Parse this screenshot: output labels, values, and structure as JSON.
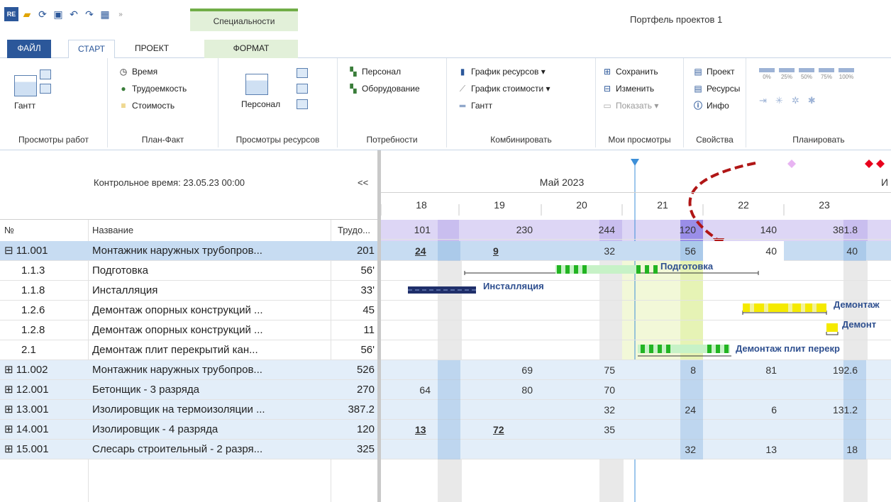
{
  "app": {
    "window_title": "Портфель проектов 1",
    "context_tab": "Специальности"
  },
  "tabs": [
    "ФАЙЛ",
    "СТАРТ",
    "ПРОЕКТ",
    "ФОРМАТ"
  ],
  "ribbon": {
    "work_views": {
      "label": "Просмотры работ",
      "gantt": "Гантт"
    },
    "plan_fact": {
      "label": "План-Факт",
      "items": [
        "Время",
        "Трудоемкость",
        "Стоимость"
      ]
    },
    "resource_views": {
      "label": "Просмотры ресурсов",
      "personnel": "Персонал"
    },
    "needs": {
      "label": "Потребности",
      "items": [
        "Персонал",
        "Оборудование"
      ]
    },
    "combine": {
      "label": "Комбинировать",
      "items": [
        "График ресурсов ▾",
        "График стоимости ▾",
        "Гантт"
      ]
    },
    "my_views": {
      "label": "Мои просмотры",
      "items": [
        "Сохранить",
        "Изменить",
        "Показать ▾"
      ]
    },
    "properties": {
      "label": "Свойства",
      "items": [
        "Проект",
        "Ресурсы",
        "Инфо"
      ]
    },
    "plan": {
      "label": "Планировать",
      "percent": [
        "0%",
        "25%",
        "50%",
        "75%",
        "100%"
      ]
    }
  },
  "control_time": "Контрольное время: 23.05.23 00:00",
  "collapse": "<<",
  "columns": {
    "num": "№",
    "name": "Название",
    "work": "Трудо..."
  },
  "timeline": {
    "month": "Май 2023",
    "next_month": "И",
    "days": [
      "18",
      "19",
      "20",
      "21",
      "22",
      "23"
    ],
    "totals": [
      "101",
      "230",
      "244",
      "120",
      "140",
      "381.8"
    ]
  },
  "rows": [
    {
      "num": "⊟ 11.001",
      "name": "Монтажник наружных трубопров...",
      "work": "201",
      "type": "sel",
      "days": [
        "24",
        "9",
        "32",
        "56",
        "40",
        "40"
      ],
      "underline": [
        0,
        1
      ]
    },
    {
      "num": "1.1.3",
      "name": "Подготовка",
      "work": "56'",
      "type": "task",
      "bar_label": "Подготовка"
    },
    {
      "num": "1.1.8",
      "name": "Инсталляция",
      "work": "33'",
      "type": "task",
      "bar_label": "Инсталляция"
    },
    {
      "num": "1.2.6",
      "name": "Демонтаж опорных конструкций ...",
      "work": "45",
      "type": "task",
      "bar_label": "Демонтаж"
    },
    {
      "num": "1.2.8",
      "name": "Демонтаж опорных конструкций ...",
      "work": "11",
      "type": "task",
      "bar_label": "Демонт"
    },
    {
      "num": "2.1",
      "name": "Демонтаж  плит перекрытий кан...",
      "work": "56'",
      "type": "task",
      "bar_label": "Демонтаж  плит перекр"
    },
    {
      "num": "⊞ 11.002",
      "name": "Монтажник наружных трубопров...",
      "work": "526",
      "type": "grp",
      "days": [
        "",
        "69",
        "75",
        "8",
        "81",
        "192.6"
      ]
    },
    {
      "num": "⊞ 12.001",
      "name": "Бетонщик - 3 разряда",
      "work": "270",
      "type": "grp",
      "days": [
        "64",
        "80",
        "70",
        "",
        "",
        ""
      ]
    },
    {
      "num": "⊞ 13.001",
      "name": "Изолировщик на термоизоляции ...",
      "work": "387.2",
      "type": "grp",
      "days": [
        "",
        "",
        "32",
        "24",
        "6",
        "131.2"
      ]
    },
    {
      "num": "⊞ 14.001",
      "name": "Изолировщик - 4 разряда",
      "work": "120",
      "type": "grp",
      "days": [
        "13",
        "72",
        "35",
        "",
        "",
        ""
      ],
      "underline": [
        0,
        1
      ]
    },
    {
      "num": "⊞ 15.001",
      "name": "Слесарь строительный - 2 разря...",
      "work": "325",
      "type": "grp",
      "days": [
        "",
        "",
        "",
        "32",
        "13",
        "18"
      ]
    }
  ],
  "colors": {
    "selected": "#c7dcf2",
    "group": "#e3eef9",
    "total": "#ddd6f5",
    "accent": "#2b579a",
    "bar_green": "#22b422",
    "bar_yellow": "#f5ea00",
    "marker_red": "#e8001c"
  }
}
